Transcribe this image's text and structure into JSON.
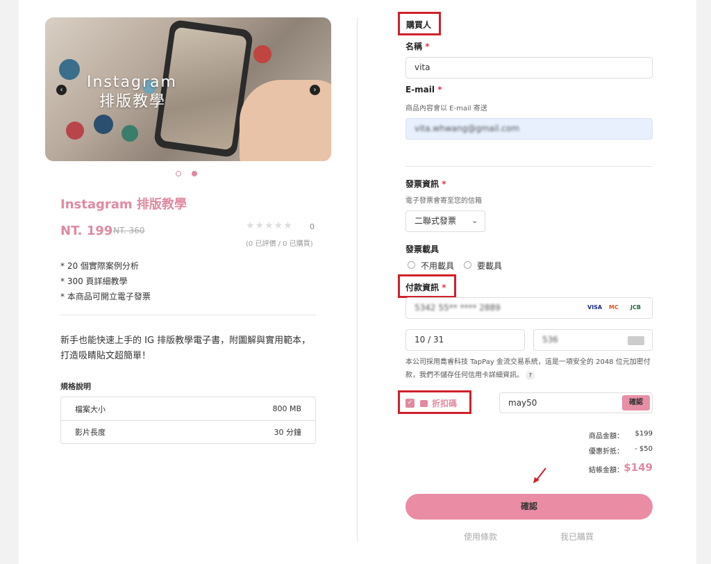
{
  "banner": {
    "line1": "Instagram",
    "line2": "排版教學",
    "prev_icon": "‹",
    "next_icon": "›"
  },
  "product": {
    "title": "Instagram 排版教學",
    "price": "NT. 199",
    "original_price": "NT. 360",
    "stars": "★★★★★",
    "rating_count": "0",
    "reviews": "(0 已評價 / 0 已購買)",
    "features": [
      "* 20 個實際案例分析",
      "* 300 頁詳細教學",
      "* 本商品可開立電子發票"
    ],
    "description": "新手也能快速上手的 IG 排版教學電子書，附圖解與實用範本，打造吸睛貼文超簡單！",
    "spec_title": "規格說明",
    "specs": [
      {
        "label": "檔案大小",
        "value": "800 MB"
      },
      {
        "label": "影片長度",
        "value": "30 分鐘"
      }
    ]
  },
  "buyer": {
    "section_title": "購買人",
    "name_label": "名稱",
    "name_value": "vita",
    "email_label": "E-mail",
    "email_hint": "商品內容會以 E-mail 寄送",
    "email_value": "vita.whwang@gmail.com",
    "required_mark": "*"
  },
  "invoice": {
    "label": "發票資訊",
    "hint": "電子發票會寄至您的信箱",
    "type_selected": "二聯式發票",
    "carrier_label": "發票載具",
    "carrier_options": [
      "不用載具",
      "要載具"
    ]
  },
  "payment": {
    "label": "付款資訊",
    "card_number": "5342 55** **** 2889",
    "card_brands": [
      "VISA",
      "MC",
      "JCB"
    ],
    "expiry": "10 / 31",
    "cvc": "536",
    "tappay_note": "本公司採用喬睿科技 TapPay 金流交易系統，這是一項安全的 2048 位元加密付款，我們不儲存任何信用卡詳細資訊。",
    "help": "?"
  },
  "discount": {
    "checkbox_mark": "✓",
    "label": "折扣碼",
    "code": "may50",
    "apply_button": "確認"
  },
  "summary": {
    "subtotal_label": "商品金額：",
    "subtotal_value": "$199",
    "discount_label": "優惠折抵：",
    "discount_value": "- $50",
    "total_label": "結帳金額：",
    "total_value": "$149"
  },
  "confirm_button": "確認",
  "footer": {
    "terms": "使用條款",
    "purchased": "我已購買"
  },
  "colors": {
    "accent": "#e08aa0",
    "button": "#ea8ca4",
    "highlight_box": "#d0202a",
    "email_bg": "#e8f0fe"
  }
}
